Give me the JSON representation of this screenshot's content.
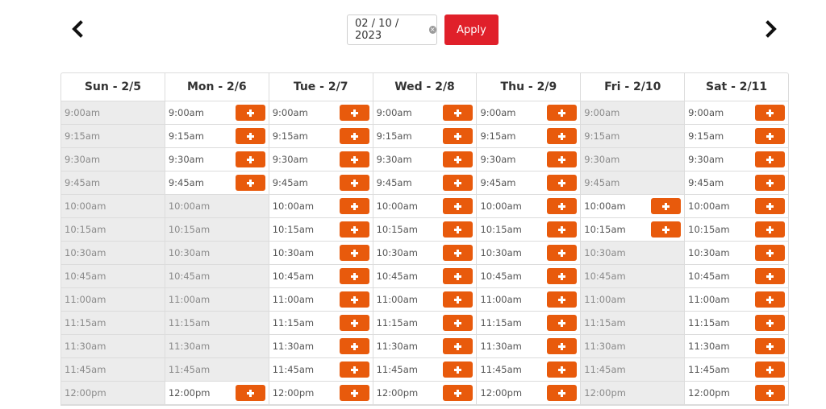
{
  "nav": {
    "prev_icon": "chevron-left-icon",
    "next_icon": "chevron-right-icon"
  },
  "date_picker": {
    "value": "02 / 10 / 2023",
    "clear_icon": "clear-icon"
  },
  "apply_label": "Apply",
  "colors": {
    "accent": "#e0202a",
    "add_button": "#e85a0c",
    "unavailable": "#ececec",
    "border": "#dcdcdc"
  },
  "days": [
    {
      "label": "Sun - 2/5",
      "available": []
    },
    {
      "label": "Mon - 2/6",
      "available": [
        "9:00am",
        "9:15am",
        "9:30am",
        "9:45am",
        "12:00pm"
      ]
    },
    {
      "label": "Tue - 2/7",
      "available": [
        "9:00am",
        "9:15am",
        "9:30am",
        "9:45am",
        "10:00am",
        "10:15am",
        "10:30am",
        "10:45am",
        "11:00am",
        "11:15am",
        "11:30am",
        "11:45am",
        "12:00pm"
      ]
    },
    {
      "label": "Wed - 2/8",
      "available": [
        "9:00am",
        "9:15am",
        "9:30am",
        "9:45am",
        "10:00am",
        "10:15am",
        "10:30am",
        "10:45am",
        "11:00am",
        "11:15am",
        "11:30am",
        "11:45am",
        "12:00pm"
      ]
    },
    {
      "label": "Thu - 2/9",
      "available": [
        "9:00am",
        "9:15am",
        "9:30am",
        "9:45am",
        "10:00am",
        "10:15am",
        "10:30am",
        "10:45am",
        "11:00am",
        "11:15am",
        "11:30am",
        "11:45am",
        "12:00pm"
      ]
    },
    {
      "label": "Fri - 2/10",
      "available": [
        "10:00am",
        "10:15am"
      ]
    },
    {
      "label": "Sat - 2/11",
      "available": [
        "9:00am",
        "9:15am",
        "9:30am",
        "9:45am",
        "10:00am",
        "10:15am",
        "10:30am",
        "10:45am",
        "11:00am",
        "11:15am",
        "11:30am",
        "11:45am",
        "12:00pm"
      ]
    }
  ],
  "times": [
    "9:00am",
    "9:15am",
    "9:30am",
    "9:45am",
    "10:00am",
    "10:15am",
    "10:30am",
    "10:45am",
    "11:00am",
    "11:15am",
    "11:30am",
    "11:45am",
    "12:00pm"
  ]
}
